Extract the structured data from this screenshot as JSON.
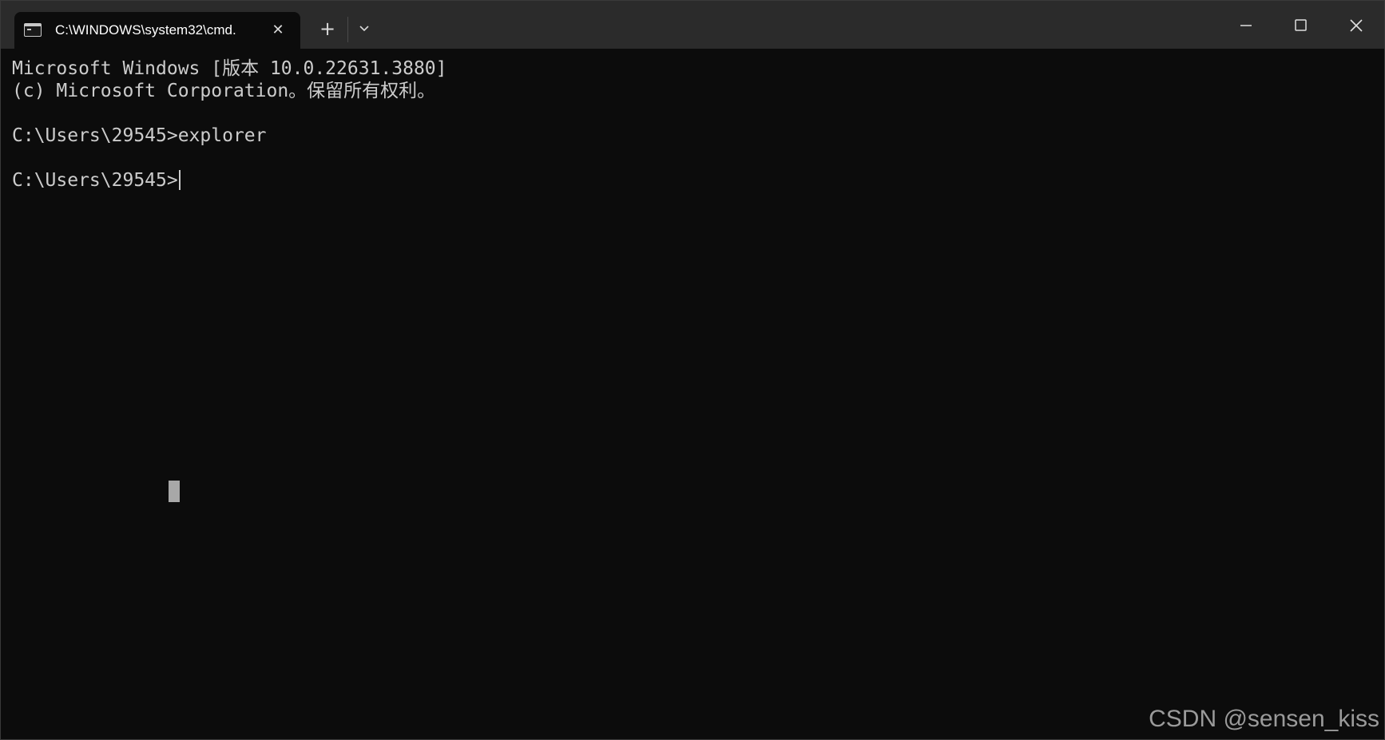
{
  "tab": {
    "title": "C:\\WINDOWS\\system32\\cmd.",
    "close_glyph": "✕"
  },
  "toolbar": {
    "new_tab_glyph": "+"
  },
  "terminal": {
    "lines": [
      "Microsoft Windows [版本 10.0.22631.3880]",
      "(c) Microsoft Corporation。保留所有权利。",
      "",
      "C:\\Users\\29545>explorer",
      "",
      "C:\\Users\\29545>"
    ]
  },
  "watermark": "CSDN @sensen_kiss",
  "colors": {
    "titlebar": "#2b2b2b",
    "terminal_bg": "#0c0c0c",
    "terminal_text": "#cccccc"
  },
  "icons": {
    "tab_icon": "cmd-icon",
    "minimize": "minimize-icon",
    "maximize": "maximize-icon",
    "close": "close-icon",
    "dropdown": "chevron-down-icon"
  }
}
